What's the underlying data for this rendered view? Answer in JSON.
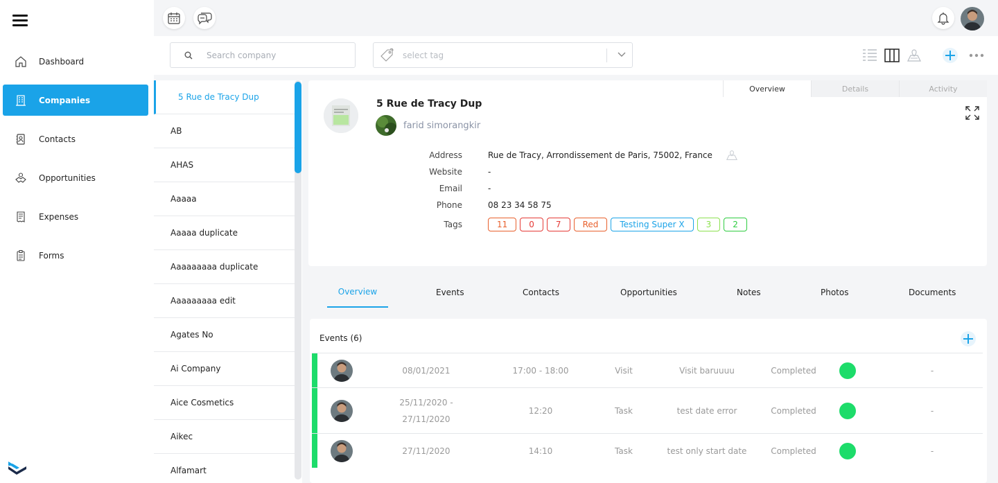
{
  "nav": {
    "items": [
      {
        "label": "Dashboard",
        "icon": "home-icon"
      },
      {
        "label": "Companies",
        "icon": "building-icon"
      },
      {
        "label": "Contacts",
        "icon": "contact-book-icon"
      },
      {
        "label": "Opportunities",
        "icon": "handshake-icon"
      },
      {
        "label": "Expenses",
        "icon": "receipt-icon"
      },
      {
        "label": "Forms",
        "icon": "clipboard-icon"
      }
    ],
    "active": "Companies"
  },
  "filter": {
    "search_placeholder": "Search company",
    "tag_placeholder": "select tag"
  },
  "companies": [
    "5 Rue de Tracy Dup",
    "AB",
    "AHAS",
    "Aaaaa",
    "Aaaaa duplicate",
    "Aaaaaaaaa duplicate",
    "Aaaaaaaaa edit",
    "Agates No",
    "Ai Company",
    "Aice Cosmetics",
    "Aikec",
    "Alfamart"
  ],
  "detail": {
    "tabs": [
      "Overview",
      "Details",
      "Activity"
    ],
    "name": "5 Rue de Tracy Dup",
    "owner": "farid simorangkir",
    "labels": {
      "address": "Address",
      "website": "Website",
      "email": "Email",
      "phone": "Phone",
      "tags": "Tags"
    },
    "address": "Rue de Tracy, Arrondissement de Paris, 75002, France",
    "website": "-",
    "email": "-",
    "phone": "08 23 34 58 75",
    "tags": [
      {
        "label": "11",
        "color": "#e8602c"
      },
      {
        "label": "0",
        "color": "#e53935"
      },
      {
        "label": "7",
        "color": "#e53935"
      },
      {
        "label": "Red",
        "color": "#e8602c"
      },
      {
        "label": "Testing Super X",
        "color": "#1aa3e8"
      },
      {
        "label": "3",
        "color": "#8be04e"
      },
      {
        "label": "2",
        "color": "#2ecc40"
      }
    ]
  },
  "section_tabs": [
    "Overview",
    "Events",
    "Contacts",
    "Opportunities",
    "Notes",
    "Photos",
    "Documents"
  ],
  "events": {
    "title": "Events (6)",
    "rows": [
      {
        "date": "08/01/2021",
        "time": "17:00 - 18:00",
        "type": "Visit",
        "name": "Visit baruuuu",
        "status": "Completed",
        "extra": "-"
      },
      {
        "date": "25/11/2020 -\n27/11/2020",
        "time": "12:20",
        "type": "Task",
        "name": "test date error",
        "status": "Completed",
        "extra": "-"
      },
      {
        "date": "27/11/2020",
        "time": "14:10",
        "type": "Task",
        "name": "test only start date",
        "status": "Completed",
        "extra": "-"
      }
    ]
  },
  "colors": {
    "accent": "#1aa3e8",
    "event_bar": "#1ddc6a",
    "status_done": "#1ddc6a"
  }
}
